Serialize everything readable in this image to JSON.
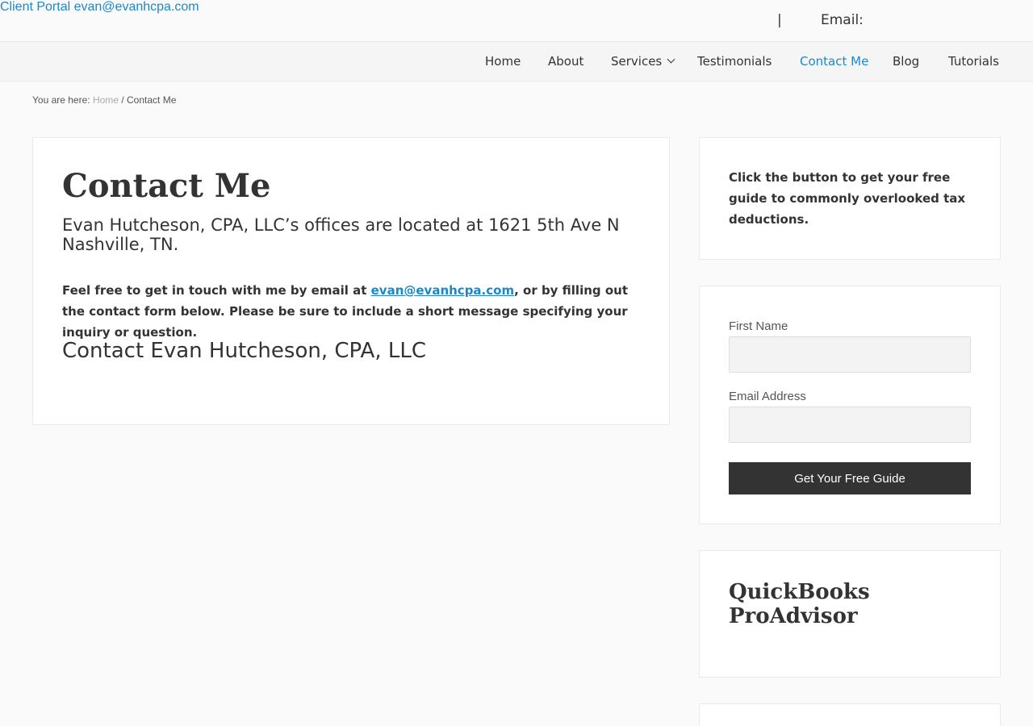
{
  "topbar": {
    "client_portal": "Client Portal",
    "separator": "|",
    "email_label": "Email:",
    "email": "evan@evanhcpa.com"
  },
  "nav": {
    "items": [
      {
        "label": "Home"
      },
      {
        "label": "About"
      },
      {
        "label": "Services"
      },
      {
        "label": "Testimonials"
      },
      {
        "label": "Contact Me"
      },
      {
        "label": "Blog"
      },
      {
        "label": "Tutorials"
      }
    ],
    "active": "Contact Me"
  },
  "breadcrumb": {
    "prefix": "You are here:",
    "home": "Home",
    "separator": "/",
    "current": "Contact Me"
  },
  "main": {
    "title": "Contact Me",
    "lead": "Evan Hutcheson, CPA, LLC’s offices are located at 1621 5th Ave N Nashville, TN.",
    "para_before": "Feel free to get in touch with me by email at ",
    "para_email": "evan@evanhcpa.com",
    "para_after": ", or by filling out the contact form below. Please be sure to include a short message specifying your inquiry or question.",
    "form_heading": "Contact Evan Hutcheson, CPA, LLC"
  },
  "sidebar": {
    "guide_text": "Click the button to get your free guide to commonly overlooked tax deductions.",
    "form": {
      "first_name_label": "First Name",
      "first_name_value": "",
      "email_label": "Email Address",
      "email_value": "",
      "submit_label": "Get Your Free Guide"
    },
    "quickbooks_title": "QuickBooks ProAdvisor"
  },
  "colors": {
    "accent": "#1e88c7",
    "button_bg": "#333333",
    "page_bg": "#fafafa"
  }
}
